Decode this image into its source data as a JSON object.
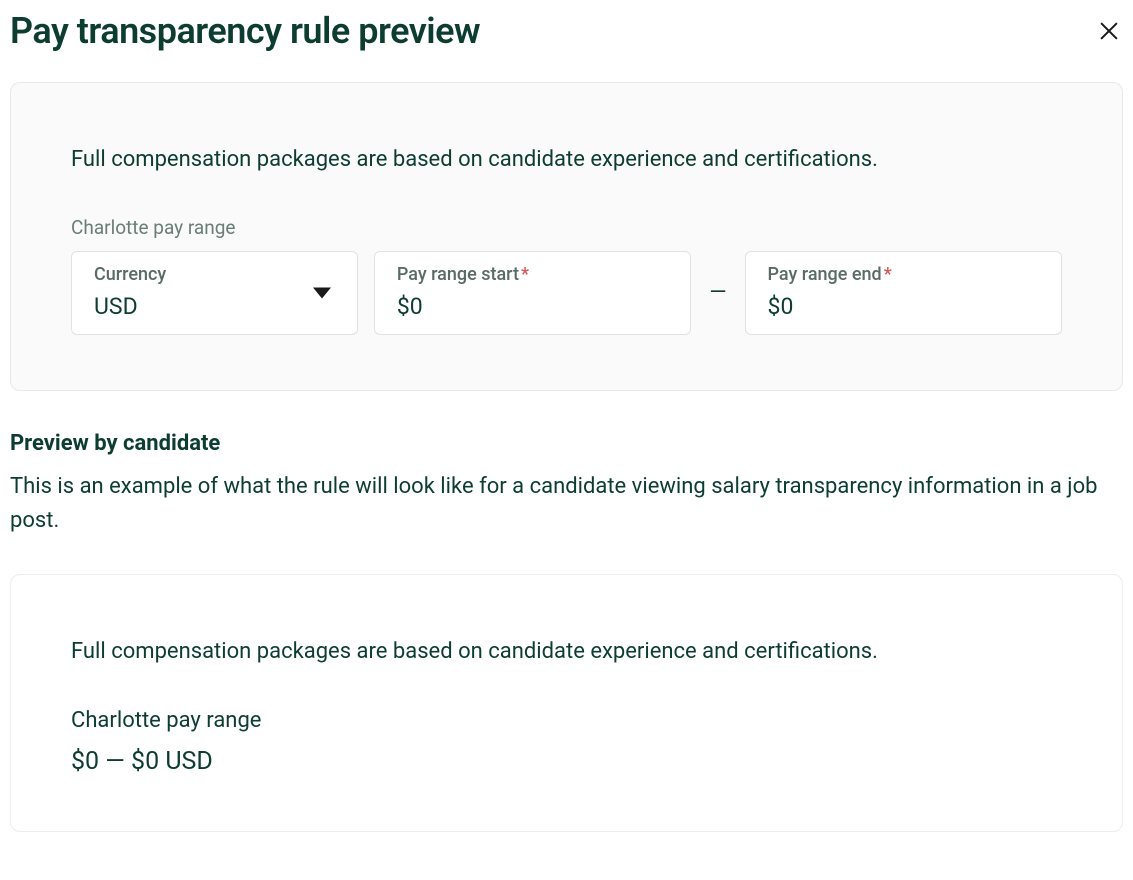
{
  "header": {
    "title": "Pay transparency rule preview"
  },
  "form": {
    "description": "Full compensation packages are based on candidate experience and certifications.",
    "range_label": "Charlotte pay range",
    "currency": {
      "label": "Currency",
      "value": "USD"
    },
    "pay_range_start": {
      "label": "Pay range start",
      "value": "$0"
    },
    "pay_range_end": {
      "label": "Pay range end",
      "value": "$0"
    },
    "dash": "—",
    "required_marker": "*"
  },
  "preview": {
    "heading": "Preview by candidate",
    "description": "This is an example of what the rule will look like for a candidate viewing salary transparency information in a job post.",
    "card": {
      "text": "Full compensation packages are based on candidate experience and certifications.",
      "range_label": "Charlotte pay range",
      "range_value": "$0 — $0 USD"
    }
  }
}
